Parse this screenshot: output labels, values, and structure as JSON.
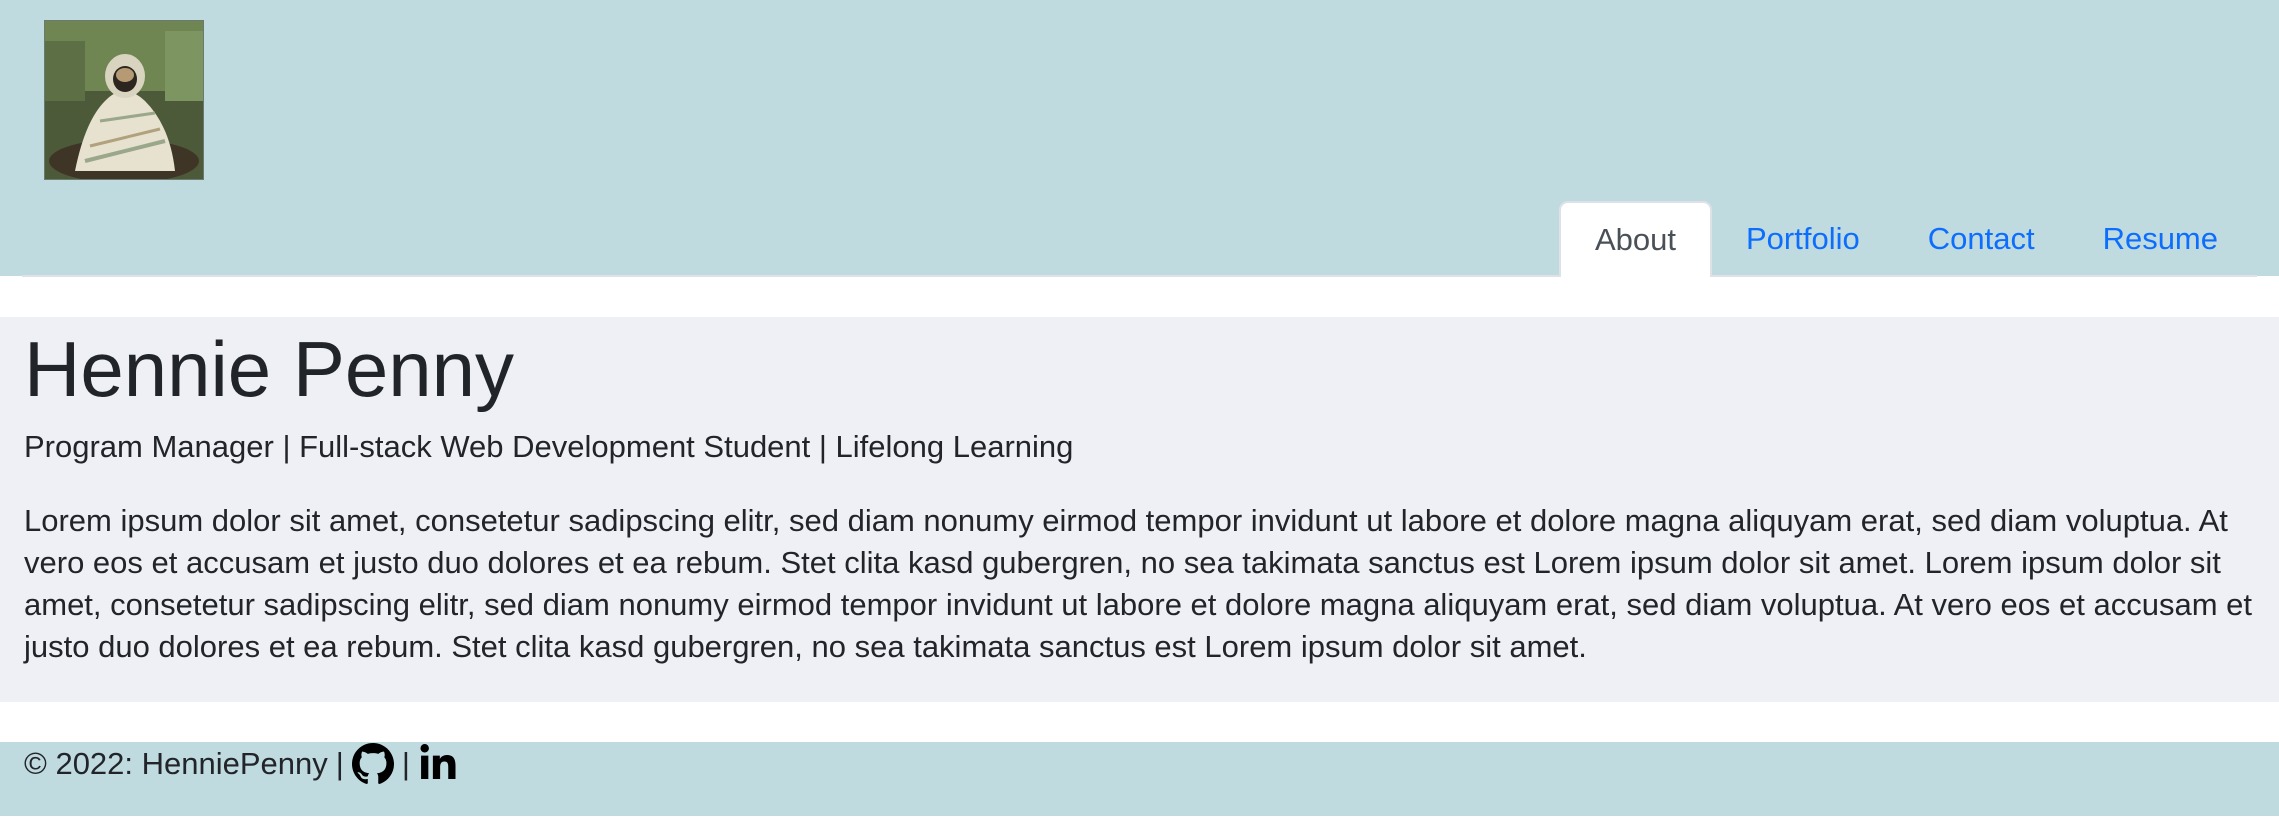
{
  "header": {
    "avatar_alt": "pug wrapped in blanket",
    "nav": [
      {
        "label": "About",
        "active": true
      },
      {
        "label": "Portfolio",
        "active": false
      },
      {
        "label": "Contact",
        "active": false
      },
      {
        "label": "Resume",
        "active": false
      }
    ]
  },
  "main": {
    "name": "Hennie Penny",
    "tagline": "Program Manager | Full-stack Web Development Student | Lifelong Learning",
    "bio": "Lorem ipsum dolor sit amet, consetetur sadipscing elitr, sed diam nonumy eirmod tempor invidunt ut labore et dolore magna aliquyam erat, sed diam voluptua. At vero eos et accusam et justo duo dolores et ea rebum. Stet clita kasd gubergren, no sea takimata sanctus est Lorem ipsum dolor sit amet. Lorem ipsum dolor sit amet, consetetur sadipscing elitr, sed diam nonumy eirmod tempor invidunt ut labore et dolore magna aliquyam erat, sed diam voluptua. At vero eos et accusam et justo duo dolores et ea rebum. Stet clita kasd gubergren, no sea takimata sanctus est Lorem ipsum dolor sit amet."
  },
  "footer": {
    "copyright": "© 2022: HenniePenny",
    "separator": "|",
    "icons": [
      "github-icon",
      "linkedin-icon"
    ]
  },
  "colors": {
    "header_bg": "#c0dbe0",
    "main_bg": "#efeff6",
    "link": "#0d6efd",
    "active_tab_text": "#495057"
  }
}
